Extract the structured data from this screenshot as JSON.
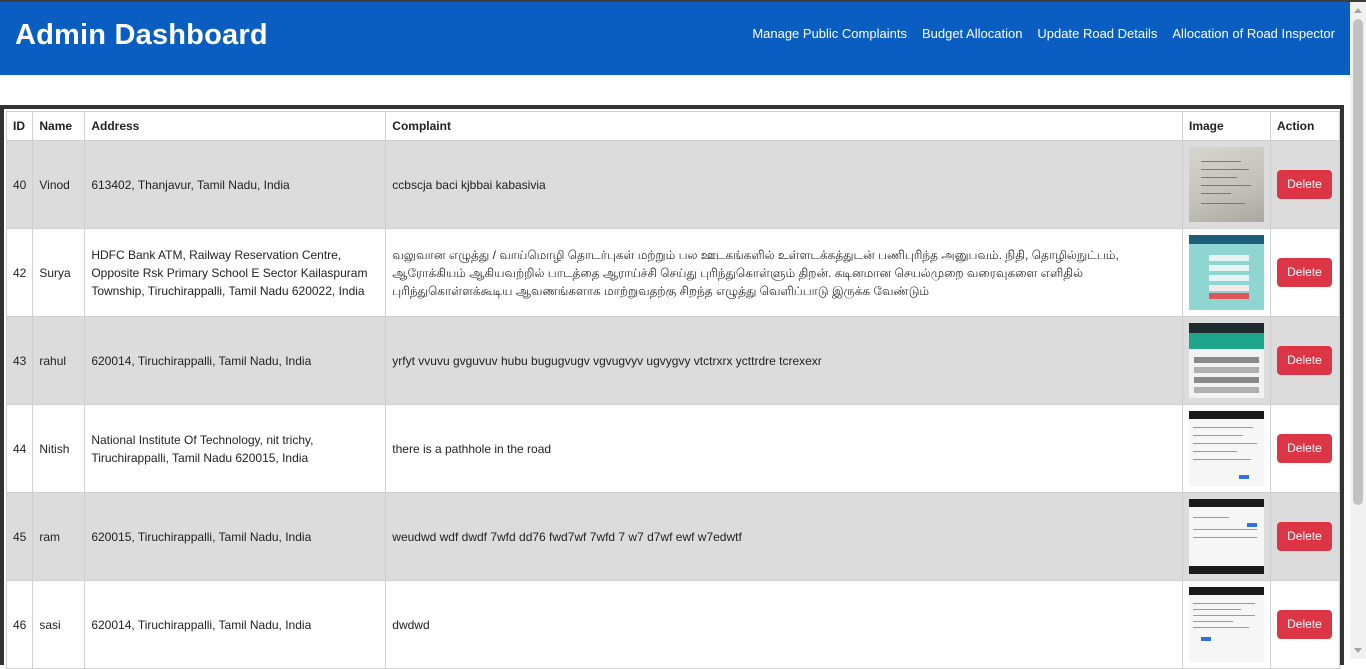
{
  "header": {
    "title": "Admin Dashboard",
    "nav": [
      {
        "label": "Manage Public Complaints"
      },
      {
        "label": "Budget Allocation"
      },
      {
        "label": "Update Road Details"
      },
      {
        "label": "Allocation of Road Inspector"
      }
    ],
    "color": "#0a5ec2"
  },
  "table": {
    "columns": [
      "ID",
      "Name",
      "Address",
      "Complaint",
      "Image",
      "Action"
    ],
    "rows": [
      {
        "id": "40",
        "name": "Vinod",
        "address": "613402, Thanjavur, Tamil Nadu, India",
        "complaint": "ccbscja baci kjbbai kabasivia",
        "image": "paper-photo-thumbnail",
        "action": "Delete"
      },
      {
        "id": "42",
        "name": "Surya",
        "address": "HDFC Bank ATM, Railway Reservation Centre, Opposite Rsk Primary School E Sector Kailaspuram Township, Tiruchirappalli, Tamil Nadu 620022, India",
        "complaint": "வலுவான எழுத்து / வாய்மொழி தொடர்புகள் மற்றும் பல ஊடகங்களில் உள்ளடக்கத்துடன் பணிபுரிந்த அனுபவம். நிதி, தொழில்நுட்பம், ஆரோக்கியம் ஆகியவற்றில் பாடத்தை ஆராய்ச்சி செய்து புரிந்துகொள்ளும் திறன். கடினமான செயல்முறை வரைவுகளை எளிதில் புரிந்துகொள்ளக்கூடிய ஆவணங்களாக மாற்றுவதற்கு சிறந்த எழுத்து வெளிப்பாடு இருக்க வேண்டும்",
        "image": "teal-form-thumbnail",
        "action": "Delete"
      },
      {
        "id": "43",
        "name": "rahul",
        "address": "620014, Tiruchirappalli, Tamil Nadu, India",
        "complaint": "yrfyt vvuvu gvguvuv hubu bugugvugv vgvugvyv ugvygvy vtctrxrx ycttrdre tcrexexr",
        "image": "green-page-thumbnail",
        "action": "Delete"
      },
      {
        "id": "44",
        "name": "Nitish",
        "address": "National Institute Of Technology, nit trichy, Tiruchirappalli, Tamil Nadu 620015, India",
        "complaint": "there is a pathhole in the road",
        "image": "screenshot-thumbnail",
        "action": "Delete"
      },
      {
        "id": "45",
        "name": "ram",
        "address": "620015, Tiruchirappalli, Tamil Nadu, India",
        "complaint": "weudwd wdf dwdf 7wfd dd76 fwd7wf 7wfd 7 w7 d7wf ewf w7edwtf",
        "image": "screenshot-thumbnail",
        "action": "Delete"
      },
      {
        "id": "46",
        "name": "sasi",
        "address": "620014, Tiruchirappalli, Tamil Nadu, India",
        "complaint": "dwdwd",
        "image": "screenshot-thumbnail",
        "action": "Delete"
      }
    ]
  },
  "colors": {
    "delete_button": "#dc3545",
    "row_alt": "#dcdcdc"
  }
}
